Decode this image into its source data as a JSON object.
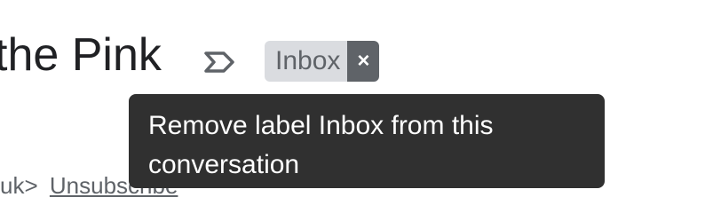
{
  "email": {
    "subject_visible": "the Pink",
    "sender_suffix": "uk>",
    "unsubscribe_label": "Unsubscribe"
  },
  "label": {
    "name": "Inbox",
    "remove_glyph": "×"
  },
  "tooltip": {
    "text": "Remove label Inbox from this conversation"
  },
  "icons": {
    "importance": "label-important-outline-icon",
    "remove": "close-icon"
  },
  "colors": {
    "chip_bg": "#dadce0",
    "chip_text": "#5f6368",
    "remove_bg": "#5f6368",
    "tooltip_bg": "#303030"
  }
}
